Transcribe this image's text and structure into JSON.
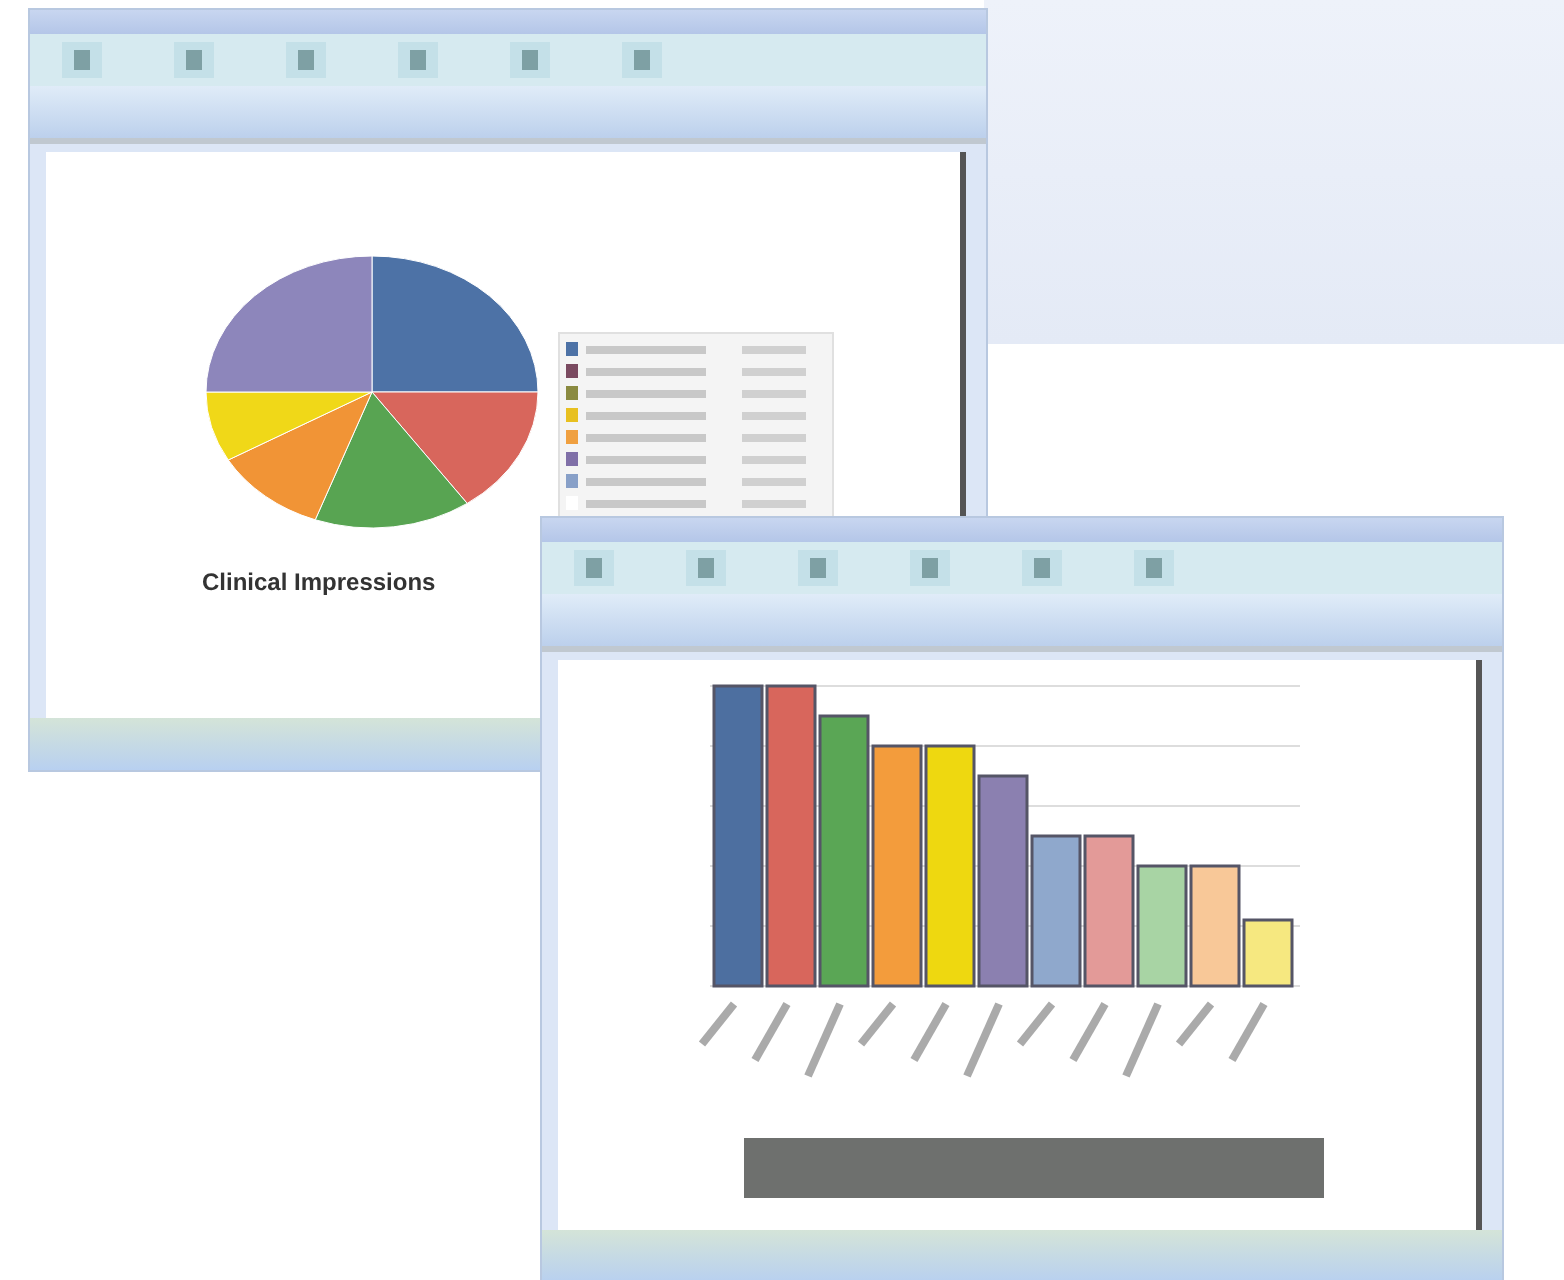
{
  "background_window": {
    "kind": "list"
  },
  "pie_window": {
    "chart_title": "Clinical Impressions",
    "slices": [
      {
        "color": "#4d72a6"
      },
      {
        "color": "#d8665c"
      },
      {
        "color": "#58a452"
      },
      {
        "color": "#f19436"
      },
      {
        "color": "#f0d818"
      },
      {
        "color": "#8d86bb"
      }
    ],
    "legend": [
      {
        "color": "#4d72a6"
      },
      {
        "color": "#7a4a60"
      },
      {
        "color": "#8a8a40"
      },
      {
        "color": "#e8c020"
      },
      {
        "color": "#f0a040"
      },
      {
        "color": "#8070a8"
      },
      {
        "color": "#88a0c8"
      },
      {
        "color": "#ffffff"
      }
    ]
  },
  "bar_window": {
    "bars": [
      {
        "color": "#4d6fa0"
      },
      {
        "color": "#d8665c"
      },
      {
        "color": "#5aa655"
      },
      {
        "color": "#f39c3c"
      },
      {
        "color": "#eed810"
      },
      {
        "color": "#8b80b0"
      },
      {
        "color": "#8fa8cc"
      },
      {
        "color": "#e39a98"
      },
      {
        "color": "#a8d4a4"
      },
      {
        "color": "#f8c898"
      },
      {
        "color": "#f6e880"
      }
    ]
  }
}
